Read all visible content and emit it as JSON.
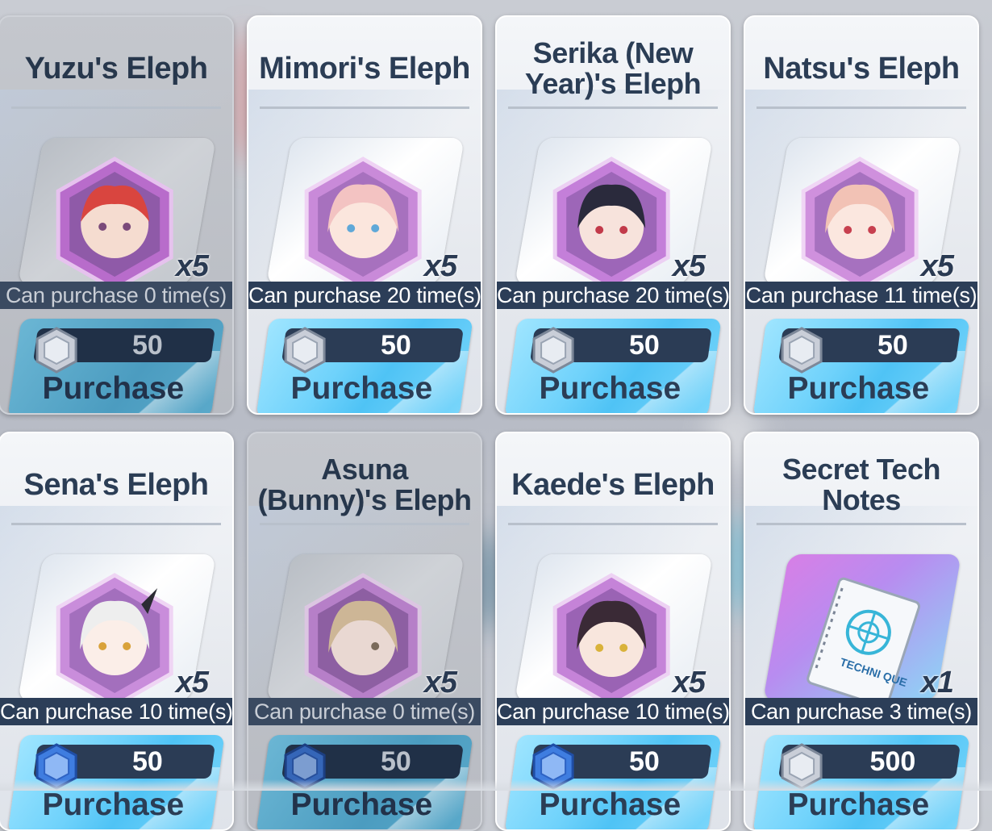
{
  "shop": {
    "items": [
      {
        "title": "Yuzu's Eleph",
        "qty": "x5",
        "limit": "Can purchase 0 time(s)",
        "price": "50",
        "button": "Purchase",
        "available": false,
        "coin": "silver",
        "art": "red-hair-portrait",
        "hex_color": "#c785d8"
      },
      {
        "title": "Mimori's Eleph",
        "qty": "x5",
        "limit": "Can purchase 20 time(s)",
        "price": "50",
        "button": "Purchase",
        "available": true,
        "coin": "silver",
        "art": "pink-hair-portrait",
        "hex_color": "#d292e0"
      },
      {
        "title": "Serika (New Year)'s Eleph",
        "qty": "x5",
        "limit": "Can purchase 20 time(s)",
        "price": "50",
        "button": "Purchase",
        "available": true,
        "coin": "silver",
        "art": "black-hair-portrait",
        "hex_color": "#c47fd9"
      },
      {
        "title": "Natsu's Eleph",
        "qty": "x5",
        "limit": "Can purchase 11 time(s)",
        "price": "50",
        "button": "Purchase",
        "available": true,
        "coin": "silver",
        "art": "peach-hair-portrait",
        "hex_color": "#cf90dd"
      },
      {
        "title": "Sena's Eleph",
        "qty": "x5",
        "limit": "Can purchase 10 time(s)",
        "price": "50",
        "button": "Purchase",
        "available": true,
        "coin": "blue",
        "art": "white-hair-portrait",
        "hex_color": "#c98ddb"
      },
      {
        "title": "Asuna (Bunny)'s Eleph",
        "qty": "x5",
        "limit": "Can purchase 0 time(s)",
        "price": "50",
        "button": "Purchase",
        "available": false,
        "coin": "blue",
        "art": "blonde-hair-portrait",
        "hex_color": "#b67fc8"
      },
      {
        "title": "Kaede's Eleph",
        "qty": "x5",
        "limit": "Can purchase 10 time(s)",
        "price": "50",
        "button": "Purchase",
        "available": true,
        "coin": "blue",
        "art": "dark-hair-portrait",
        "hex_color": "#c583d8"
      },
      {
        "title": "Secret Tech Notes",
        "qty": "x1",
        "limit": "Can purchase 3 time(s)",
        "price": "500",
        "button": "Purchase",
        "available": true,
        "coin": "silver",
        "art": "technique-notebook",
        "hex_color": ""
      }
    ],
    "notebook_text": "TECHNI QUE"
  },
  "colors": {
    "accent_button": "#4fc3f5",
    "title_text": "#2b3d55",
    "limit_bar": "#2c3e58",
    "eleph_hex": "#c785d8"
  }
}
